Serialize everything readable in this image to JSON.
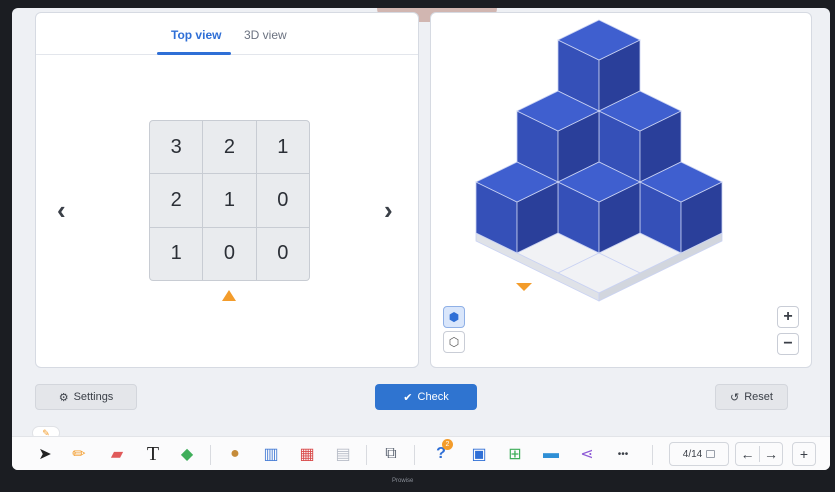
{
  "tabs": [
    {
      "label": "Top view",
      "active": true
    },
    {
      "label": "3D view",
      "active": false
    }
  ],
  "grid": [
    [
      3,
      2,
      1
    ],
    [
      2,
      1,
      0
    ],
    [
      1,
      0,
      0
    ]
  ],
  "grid_cells": [
    "3",
    "2",
    "1",
    "2",
    "1",
    "0",
    "1",
    "0",
    "0"
  ],
  "nav": {
    "prev": "‹",
    "next": "›"
  },
  "zoom": {
    "plus": "+",
    "minus": "−"
  },
  "buttons": {
    "settings": "Settings",
    "check": "Check",
    "reset": "Reset"
  },
  "icons": {
    "settings": "⚙",
    "check": "✔",
    "reset": "↺"
  },
  "taskbar": {
    "page_indicator": "4/14",
    "back": "←",
    "forward": "→",
    "add": "+",
    "more": "•••",
    "text_tool": "T",
    "badge": "2"
  },
  "bezel": {
    "brand": "Prowise"
  },
  "colors": {
    "accent": "#2f6fd6",
    "cube_top": "#3f5fcf",
    "cube_left": "#3550b8",
    "cube_right": "#2a3f9a",
    "marker": "#f39c2b"
  }
}
